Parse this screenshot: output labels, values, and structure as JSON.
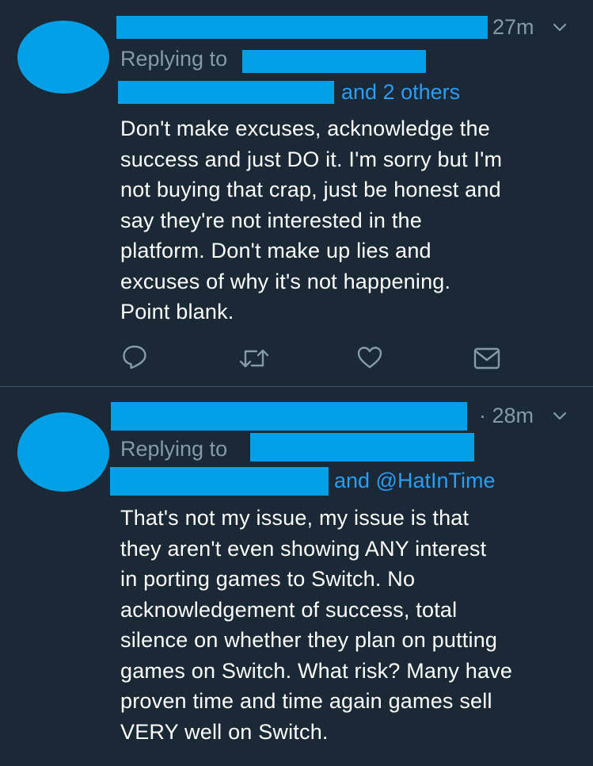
{
  "theme": {
    "background": "#1b2836",
    "redaction_color": "#019fe6",
    "link_color": "#2a9df4",
    "muted_color": "#8899a6",
    "text_color": "#ffffff"
  },
  "tweets": [
    {
      "time": "27m",
      "replying_prefix": "Replying to",
      "replying_suffix": "and 2 others",
      "text": "Don't make excuses, acknowledge the\nsuccess and just DO it. I'm sorry but I'm\nnot buying that crap, just be honest and\nsay they're not interested in the\nplatform. Don't make up lies and\nexcuses of why it's not happening.\nPoint blank.",
      "actions": [
        "reply-icon",
        "retweet-icon",
        "like-icon",
        "direct-message-icon"
      ]
    },
    {
      "time": "· 28m",
      "replying_prefix": "Replying to",
      "replying_suffix": "and @HatInTime",
      "text": "That's not my issue, my issue is that\nthey aren't even showing ANY interest\nin porting games to Switch. No\nacknowledgement of success, total\nsilence on whether they plan on putting\ngames on Switch. What risk? Many have\nproven time and time again games sell\nVERY well on Switch."
    }
  ]
}
